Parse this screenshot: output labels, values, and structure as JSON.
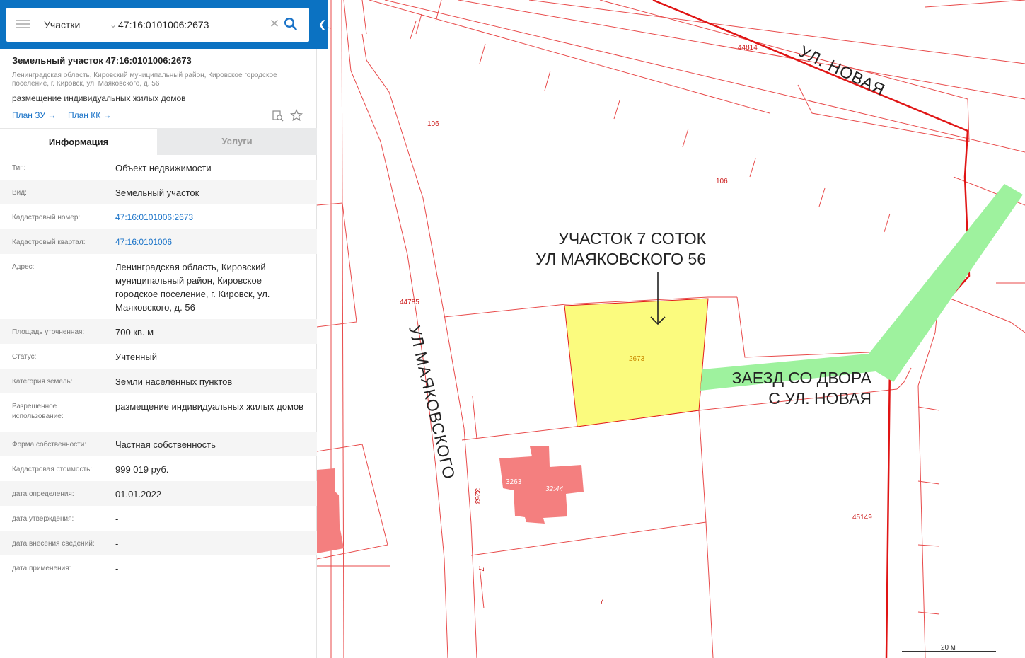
{
  "search": {
    "type_label": "Участки",
    "query": "47:16:0101006:2673"
  },
  "card": {
    "title": "Земельный участок 47:16:0101006:2673",
    "address": "Ленинградская область, Кировский муниципальный район, Кировское городское поселение, г. Кировск, ул. Маяковского, д. 56",
    "use": "размещение индивидуальных жилых домов",
    "link_zu": "План ЗУ →",
    "link_kk": "План КК →"
  },
  "tabs": {
    "info": "Информация",
    "services": "Услуги"
  },
  "info": [
    {
      "key": "Тип:",
      "value": "Объект недвижимости"
    },
    {
      "key": "Вид:",
      "value": "Земельный участок"
    },
    {
      "key": "Кадастровый номер:",
      "value": "47:16:0101006:2673"
    },
    {
      "key": "Кадастровый квартал:",
      "value": "47:16:0101006"
    },
    {
      "key": "Адрес:",
      "value": "Ленинградская область, Кировский муниципальный район, Кировское городское поселение, г. Кировск, ул. Маяковского, д. 56"
    },
    {
      "key": "Площадь уточненная:",
      "value": "700 кв. м"
    },
    {
      "key": "Статус:",
      "value": "Учтенный"
    },
    {
      "key": "Категория земель:",
      "value": "Земли населённых пунктов"
    },
    {
      "key": "Разрешенное использование:",
      "value": "размещение индивидуальных жилых домов"
    },
    {
      "key": "Форма собственности:",
      "value": "Частная собственность"
    },
    {
      "key": "Кадастровая стоимость:",
      "value": "999 019 руб."
    },
    {
      "key": "дата определения:",
      "value": "01.01.2022"
    },
    {
      "key": "дата утверждения:",
      "value": "-"
    },
    {
      "key": "дата внесения сведений:",
      "value": "-"
    },
    {
      "key": "дата применения:",
      "value": "-"
    }
  ],
  "map": {
    "parcel_labels": {
      "l106a": "106",
      "l106b": "106",
      "l44814": "44814",
      "l44785": "44785",
      "l2673": "2673",
      "l3263a": "3263",
      "l3263b": "3263",
      "l3244": "32:44",
      "l45149": "45149",
      "l7a": "7",
      "l7b": "7"
    },
    "street_novaya": "УЛ. НОВАЯ",
    "street_mayakovskogo": "УЛ МАЯКОВСКОГО",
    "annotation_line1": "УЧАСТОК 7 СОТОК",
    "annotation_line2": "УЛ МАЯКОВСКОГО 56",
    "entry_line1": "ЗАЕЗД СО ДВОРА",
    "entry_line2": "С УЛ. НОВАЯ",
    "scale": "20 м",
    "colors": {
      "boundary": "#e21b1b",
      "selected_parcel": "#fbfb7e",
      "building": "#f47f7f",
      "entry_path": "#9ef29e"
    }
  }
}
